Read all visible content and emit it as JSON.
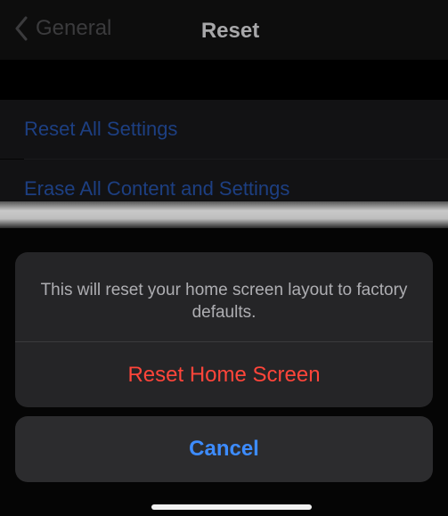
{
  "navbar": {
    "back_label": "General",
    "title": "Reset"
  },
  "settings": {
    "rows": [
      {
        "label": "Reset All Settings"
      },
      {
        "label": "Erase All Content and Settings"
      }
    ]
  },
  "action_sheet": {
    "message": "This will reset your home screen layout to factory defaults.",
    "action_label": "Reset Home Screen",
    "cancel_label": "Cancel"
  },
  "colors": {
    "destructive": "#ff453a",
    "cancel": "#3d8cff",
    "row_link": "#1d3f82"
  }
}
